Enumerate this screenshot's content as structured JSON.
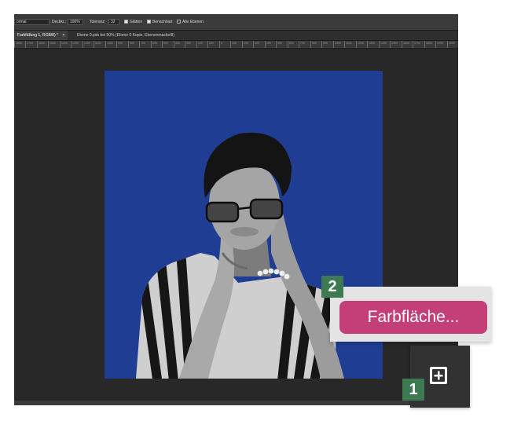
{
  "options_bar": {
    "mode": "ormal",
    "opacity_label": "Deckkr.:",
    "opacity_value": "100%",
    "tolerance_label": "Toleranz:",
    "tolerance_value": "32",
    "smooth_label": "Glätten",
    "contiguous_label": "Benachbart",
    "all_layers_label": "Alle Ebenen"
  },
  "tabs": [
    {
      "label": "Farbfüllung 1, RGB/8) *"
    },
    {
      "label": "Ebene 0.psb bei 50% (Ebene 0 Kopie, Ebenenmaske/8)"
    }
  ],
  "ruler": {
    "numbers": [
      "1800",
      "1700",
      "1600",
      "1500",
      "1400",
      "1300",
      "1200",
      "1100",
      "1000",
      "900",
      "800",
      "700",
      "600",
      "500",
      "400",
      "300",
      "200",
      "100",
      "0",
      "100",
      "200",
      "300",
      "400",
      "500",
      "600",
      "700",
      "800",
      "900",
      "1000",
      "1100",
      "1200",
      "1300",
      "1400",
      "1500",
      "1600",
      "1700",
      "1800",
      "1900",
      "2000"
    ]
  },
  "document": {
    "background_color": "#1f3e93"
  },
  "menu": {
    "fill_item_label": "Farbfläche..."
  },
  "panel": {
    "add_icon": "plus-square-icon"
  },
  "badges": {
    "step1": "1",
    "step2": "2"
  },
  "colors": {
    "accent_pink": "#c43f78",
    "badge_green": "#3d7a52"
  }
}
